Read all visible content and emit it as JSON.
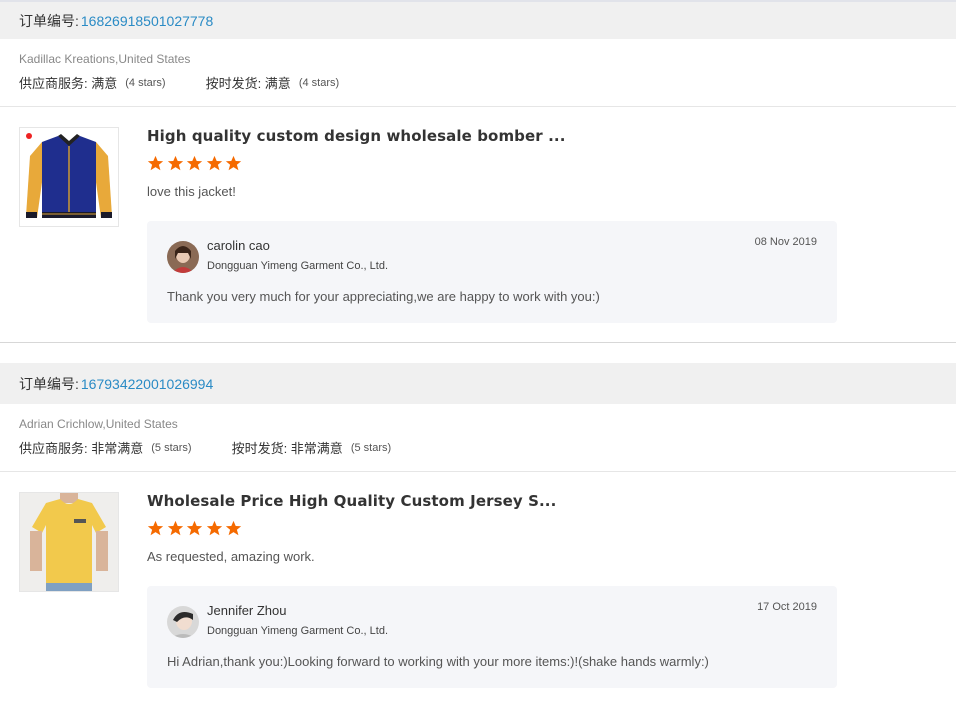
{
  "orders": [
    {
      "order_label": "订单编号: ",
      "order_number": "16826918501027778",
      "buyer": "Kadillac Kreations,United States",
      "supplier_service_label": "供应商服务: 满意",
      "supplier_service_stars": "(4 stars)",
      "shipping_label": "按时发货: 满意",
      "shipping_stars": "(4 stars)",
      "product_title": "High quality custom design wholesale bomber ...",
      "rating": 5,
      "comment": "love this jacket!",
      "reply": {
        "name": "carolin cao",
        "company": "Dongguan Yimeng Garment Co., Ltd.",
        "date": "08 Nov 2019",
        "text": "Thank you very much for your appreciating,we are happy to work with you:)"
      }
    },
    {
      "order_label": "订单编号: ",
      "order_number": "16793422001026994",
      "buyer": "Adrian Crichlow,United States",
      "supplier_service_label": "供应商服务: 非常满意",
      "supplier_service_stars": "(5 stars)",
      "shipping_label": "按时发货: 非常满意",
      "shipping_stars": "(5 stars)",
      "product_title": "Wholesale Price High Quality Custom Jersey S...",
      "rating": 5,
      "comment": "As requested, amazing work.",
      "reply": {
        "name": "Jennifer Zhou",
        "company": "Dongguan Yimeng Garment Co., Ltd.",
        "date": "17 Oct 2019",
        "text": "Hi Adrian,thank you:)Looking forward to working with your more items:)!(shake hands warmly:)"
      }
    }
  ],
  "colors": {
    "star": "#f56a00",
    "order_number": "#2a8bc5"
  }
}
